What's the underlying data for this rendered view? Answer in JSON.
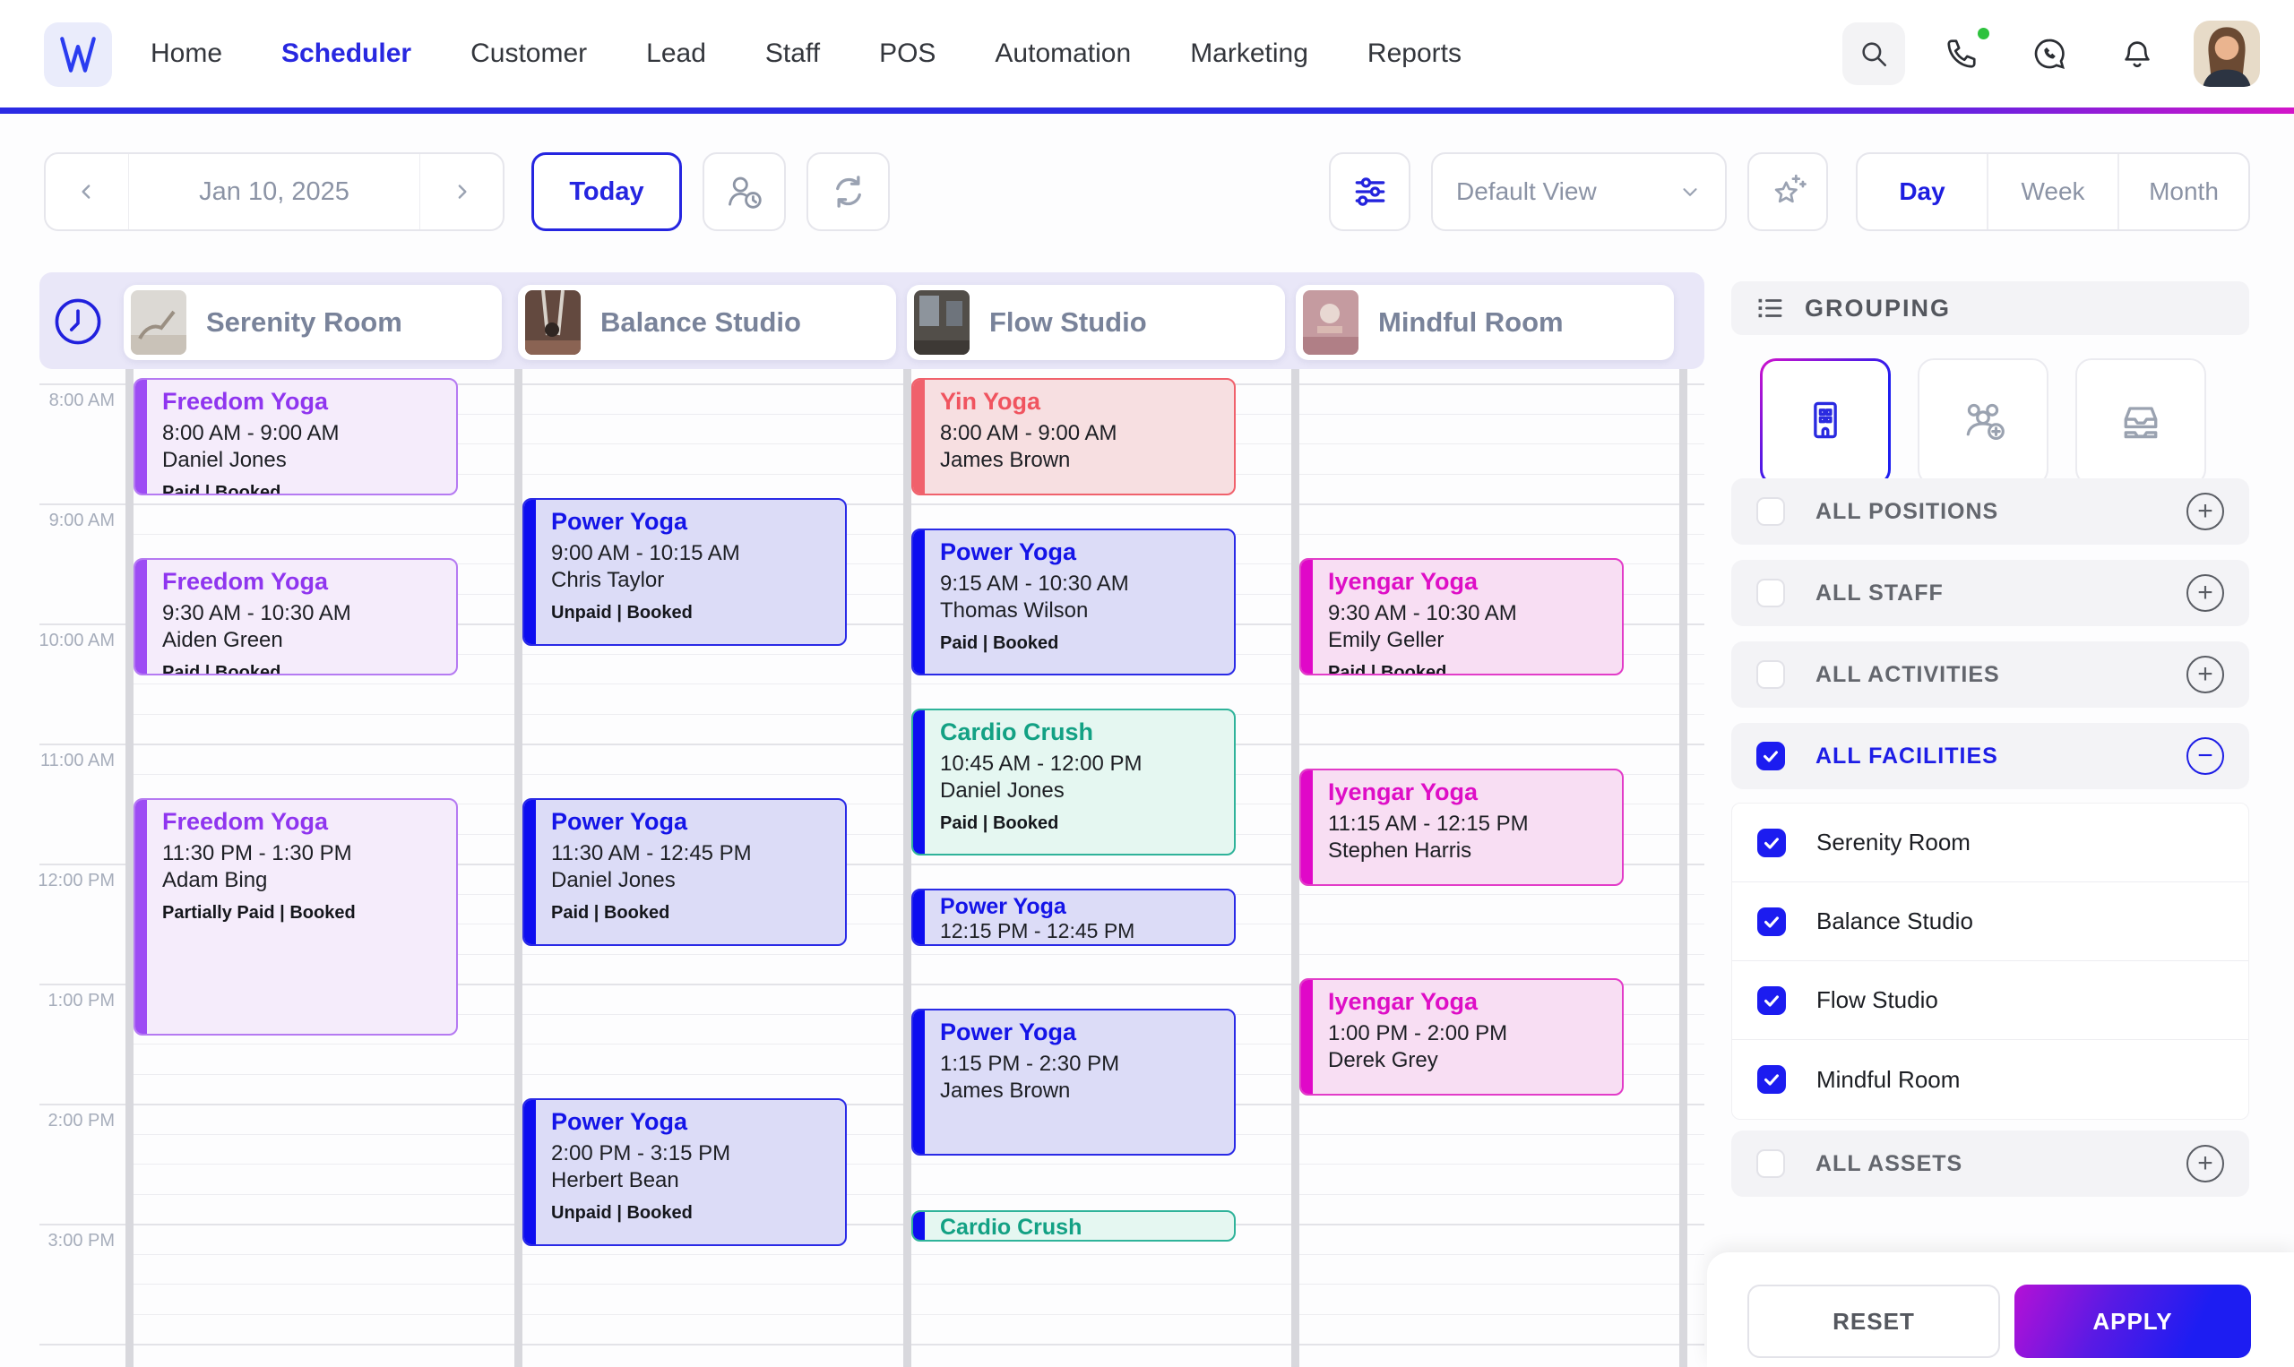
{
  "nav": {
    "logo": "W",
    "items": [
      {
        "label": "Home",
        "active": false
      },
      {
        "label": "Scheduler",
        "active": true
      },
      {
        "label": "Customer",
        "active": false
      },
      {
        "label": "Lead",
        "active": false
      },
      {
        "label": "Staff",
        "active": false
      },
      {
        "label": "POS",
        "active": false
      },
      {
        "label": "Automation",
        "active": false
      },
      {
        "label": "Marketing",
        "active": false
      },
      {
        "label": "Reports",
        "active": false
      }
    ]
  },
  "toolbar": {
    "date_label": "Jan 10, 2025",
    "today_label": "Today",
    "view_dropdown": "Default View",
    "view_modes": [
      {
        "label": "Day",
        "active": true
      },
      {
        "label": "Week",
        "active": false
      },
      {
        "label": "Month",
        "active": false
      }
    ]
  },
  "calendar": {
    "resources": [
      {
        "name": "Serenity Room"
      },
      {
        "name": "Balance Studio"
      },
      {
        "name": "Flow Studio"
      },
      {
        "name": "Mindful Room"
      }
    ],
    "time_labels": [
      "8:00 AM",
      "9:00 AM",
      "10:00 AM",
      "11:00 AM",
      "12:00 PM",
      "1:00 PM",
      "2:00 PM",
      "3:00 PM"
    ],
    "events": [
      {
        "resource": 0,
        "color": "purple",
        "title": "Freedom Yoga",
        "time": "8:00 AM - 9:00 AM",
        "person": "Daniel Jones",
        "status": "Paid | Booked",
        "start_min": 0,
        "dur_min": 60
      },
      {
        "resource": 0,
        "color": "purple",
        "title": "Freedom Yoga",
        "time": "9:30 AM - 10:30 AM",
        "person": "Aiden Green",
        "status": "Paid | Booked",
        "start_min": 90,
        "dur_min": 60
      },
      {
        "resource": 0,
        "color": "purple",
        "title": "Freedom Yoga",
        "time": "11:30 PM - 1:30 PM",
        "person": "Adam Bing",
        "status": "Partially Paid | Booked",
        "start_min": 210,
        "dur_min": 120
      },
      {
        "resource": 1,
        "color": "blue",
        "title": "Power Yoga",
        "time": "9:00 AM - 10:15 AM",
        "person": "Chris Taylor",
        "status": "Unpaid | Booked",
        "start_min": 60,
        "dur_min": 75
      },
      {
        "resource": 1,
        "color": "blue",
        "title": "Power Yoga",
        "time": "11:30 AM - 12:45 PM",
        "person": "Daniel Jones",
        "status": "Paid | Booked",
        "start_min": 210,
        "dur_min": 75
      },
      {
        "resource": 1,
        "color": "blue",
        "title": "Power Yoga",
        "time": "2:00 PM - 3:15 PM",
        "person": "Herbert Bean",
        "status": "Unpaid | Booked",
        "start_min": 360,
        "dur_min": 75
      },
      {
        "resource": 2,
        "color": "red",
        "title": "Yin Yoga",
        "time": "8:00 AM - 9:00 AM",
        "person": "James Brown",
        "start_min": 0,
        "dur_min": 60
      },
      {
        "resource": 2,
        "color": "blue",
        "title": "Power Yoga",
        "time": "9:15 AM - 10:30 AM",
        "person": "Thomas Wilson",
        "status": "Paid | Booked",
        "start_min": 75,
        "dur_min": 75
      },
      {
        "resource": 2,
        "color": "teal",
        "title": "Cardio Crush",
        "time": "10:45 AM - 12:00 PM",
        "person": "Daniel Jones",
        "status": "Paid | Booked",
        "start_min": 165,
        "dur_min": 75
      },
      {
        "resource": 2,
        "color": "blue",
        "title": "Power Yoga",
        "time": "12:15 PM - 12:45 PM",
        "start_min": 255,
        "dur_min": 30
      },
      {
        "resource": 2,
        "color": "blue",
        "title": "Power Yoga",
        "time": "1:15 PM - 2:30 PM",
        "person": "James Brown",
        "start_min": 315,
        "dur_min": 75
      },
      {
        "resource": 2,
        "color": "teal",
        "title": "Cardio Crush",
        "start_min": 416,
        "dur_min": 17
      },
      {
        "resource": 3,
        "color": "magenta",
        "title": "Iyengar Yoga",
        "time": "9:30 AM - 10:30 AM",
        "person": "Emily Geller",
        "status": "Paid | Booked",
        "start_min": 90,
        "dur_min": 60
      },
      {
        "resource": 3,
        "color": "magenta",
        "title": "Iyengar Yoga",
        "time": "11:15 AM - 12:15 PM",
        "person": "Stephen Harris",
        "start_min": 195,
        "dur_min": 60
      },
      {
        "resource": 3,
        "color": "magenta",
        "title": "Iyengar Yoga",
        "time": "1:00 PM - 2:00 PM",
        "person": "Derek Grey",
        "start_min": 300,
        "dur_min": 60
      }
    ]
  },
  "sidebar": {
    "grouping_label": "GROUPING",
    "group_buttons": [
      {
        "icon": "facility-building-icon",
        "active": true
      },
      {
        "icon": "staff-people-icon",
        "active": false
      },
      {
        "icon": "asset-tray-icon",
        "active": false
      }
    ],
    "sections": [
      {
        "label": "ALL POSITIONS",
        "checked": false,
        "expanded": false
      },
      {
        "label": "ALL STAFF",
        "checked": false,
        "expanded": false
      },
      {
        "label": "ALL ACTIVITIES",
        "checked": false,
        "expanded": false
      },
      {
        "label": "ALL FACILITIES",
        "checked": true,
        "expanded": true
      }
    ],
    "facilities": [
      {
        "label": "Serenity Room",
        "checked": true
      },
      {
        "label": "Balance Studio",
        "checked": true
      },
      {
        "label": "Flow Studio",
        "checked": true
      },
      {
        "label": "Mindful Room",
        "checked": true
      }
    ],
    "assets_section": {
      "label": "ALL ASSETS",
      "checked": false,
      "expanded": false
    },
    "reset_label": "RESET",
    "apply_label": "APPLY"
  },
  "colors": {
    "accent_blue": "#1d1de0",
    "accent_magenta": "#d013c9",
    "checkbox_checked": "#1c1cf0",
    "band_lavender": "#e9e7f8",
    "event_purple": "#9d4cf4",
    "event_blue": "#0d0df0",
    "event_red": "#f0616c",
    "event_teal": "#13a184",
    "event_magenta": "#e008c8"
  }
}
